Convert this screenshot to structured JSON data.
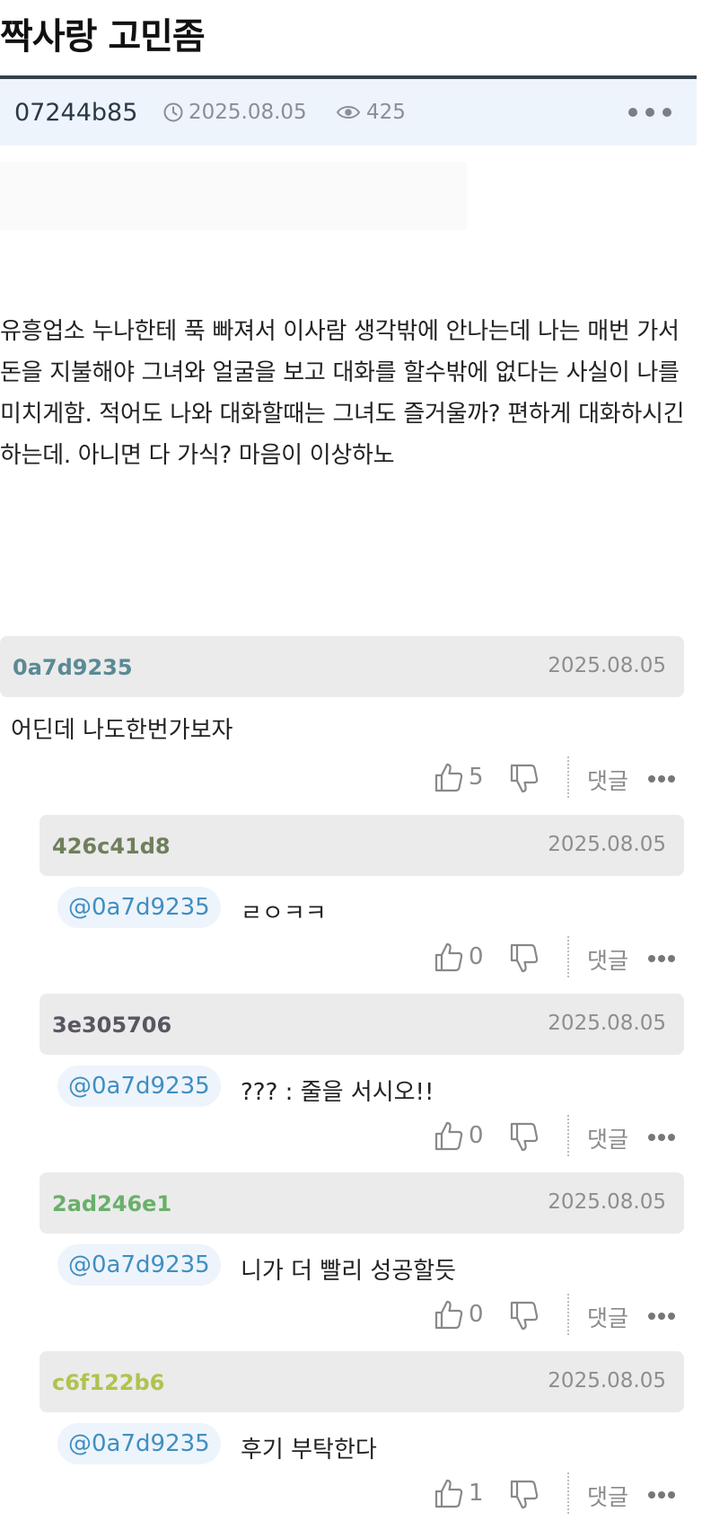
{
  "post": {
    "title": "짝사랑 고민좀",
    "author": "07244b85",
    "date": "2025.08.05",
    "views": "425",
    "body": "유흥업소 누나한테 푹 빠져서 이사람 생각밖에 안나는데 나는 매번 가서 돈을 지불해야 그녀와 얼굴을 보고 대화를 할수밖에 없다는 사실이 나를 미치게함. 적어도 나와 대화할때는 그녀도 즐거울까? 편하게 대화하시긴 하는데. 아니면 다 가식? 마음이 이상하노"
  },
  "icons": {
    "date": "clock-icon",
    "views": "eye-icon",
    "more": "more-dots-icon",
    "like": "thumbs-up-icon",
    "dislike": "thumbs-down-icon"
  },
  "reply_label": "댓글",
  "comments": [
    {
      "author": "0a7d9235",
      "author_color": "#5a8a95",
      "date": "2025.08.05",
      "mention": "",
      "text": "어딘데 나도한번가보자",
      "likes": "5"
    },
    {
      "author": "426c41d8",
      "author_color": "#6f7f5b",
      "date": "2025.08.05",
      "mention": "@0a7d9235",
      "text": "ㄹㅇㅋㅋ",
      "likes": "0"
    },
    {
      "author": "3e305706",
      "author_color": "#5a5560",
      "date": "2025.08.05",
      "mention": "@0a7d9235",
      "text": "??? : 줄을 서시오!!",
      "likes": "0"
    },
    {
      "author": "2ad246e1",
      "author_color": "#6aaf6a",
      "date": "2025.08.05",
      "mention": "@0a7d9235",
      "text": "니가 더 빨리 성공할듯",
      "likes": "0"
    },
    {
      "author": "c6f122b6",
      "author_color": "#b1c24e",
      "date": "2025.08.05",
      "mention": "@0a7d9235",
      "text": "후기 부탁한다",
      "likes": "1"
    }
  ]
}
